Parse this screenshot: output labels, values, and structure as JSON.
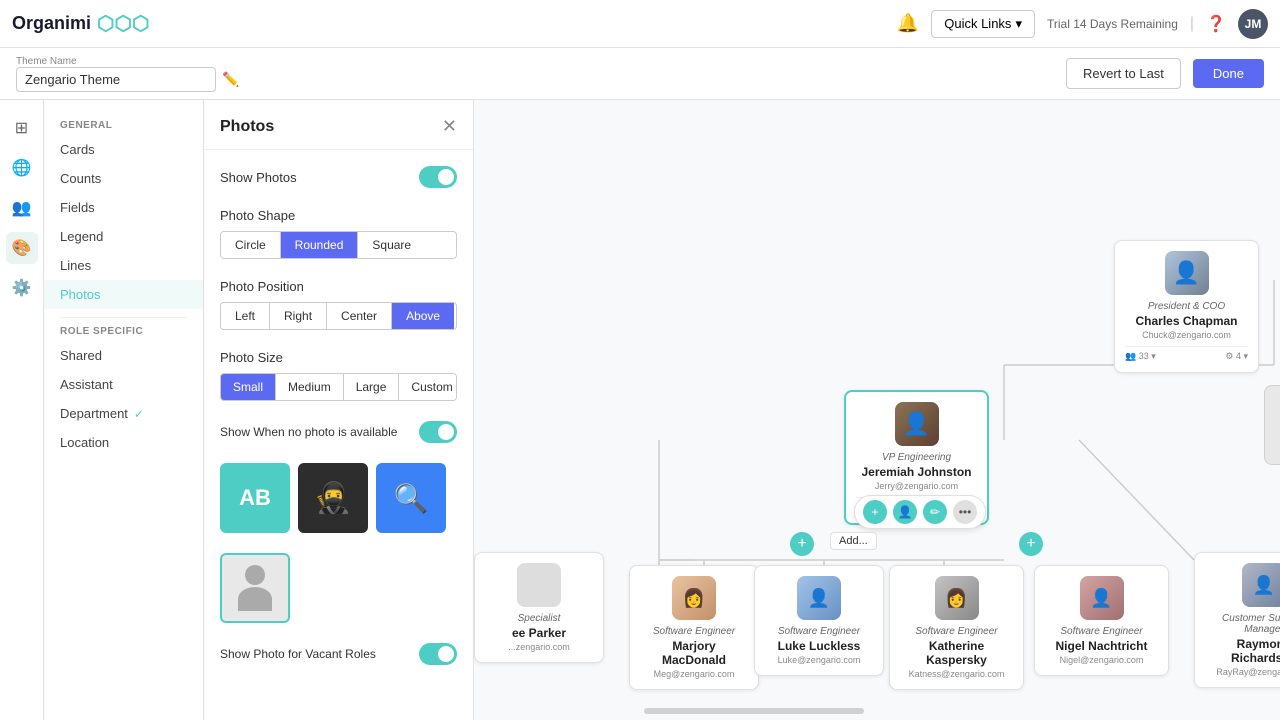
{
  "topbar": {
    "logo_text": "Organimi",
    "quick_links_label": "Quick Links",
    "trial_text": "Trial 14 Days Remaining",
    "avatar_initials": "JM"
  },
  "theme_bar": {
    "theme_label": "Theme Name",
    "theme_name": "Zengario Theme",
    "revert_label": "Revert to Last",
    "done_label": "Done"
  },
  "settings_nav": {
    "general_label": "GENERAL",
    "items": [
      {
        "label": "Cards",
        "active": false
      },
      {
        "label": "Counts",
        "active": false
      },
      {
        "label": "Fields",
        "active": false
      },
      {
        "label": "Legend",
        "active": false
      },
      {
        "label": "Lines",
        "active": false
      },
      {
        "label": "Photos",
        "active": true
      }
    ],
    "role_specific_label": "ROLE SPECIFIC",
    "role_items": [
      {
        "label": "Shared",
        "active": false,
        "check": false
      },
      {
        "label": "Assistant",
        "active": false,
        "check": false
      },
      {
        "label": "Department",
        "active": false,
        "check": true
      },
      {
        "label": "Location",
        "active": false,
        "check": false
      }
    ]
  },
  "photos_panel": {
    "title": "Photos",
    "show_photos_label": "Show Photos",
    "photo_shape_label": "Photo Shape",
    "shapes": [
      "Circle",
      "Rounded",
      "Square"
    ],
    "active_shape": "Rounded",
    "photo_position_label": "Photo Position",
    "positions": [
      "Left",
      "Right",
      "Center",
      "Above"
    ],
    "active_position": "Above",
    "photo_size_label": "Photo Size",
    "sizes": [
      "Small",
      "Medium",
      "Large",
      "Custom"
    ],
    "active_size": "Small",
    "show_no_photo_label": "Show When no photo is available",
    "show_vacant_label": "Show Photo for Vacant Roles"
  },
  "org": {
    "coo_card": {
      "role": "President & COO",
      "name": "Charles Chapman",
      "email": "Chuck@zengario.com"
    },
    "vp_card": {
      "role": "VP Engineering",
      "name": "Jeremiah Johnston",
      "email": "Jerry@zengario.com"
    },
    "engineers": [
      {
        "role": "Software Engineer",
        "name": "Marjory MacDonald",
        "email": "Meg@zengario.com"
      },
      {
        "role": "Software Engineer",
        "name": "Luke Luckless",
        "email": "Luke@zengario.com"
      },
      {
        "role": "Software Engineer",
        "name": "Katherine Kaspersky",
        "email": "Katness@zengario.com"
      },
      {
        "role": "Software Engineer",
        "name": "Nigel Nachtricht",
        "email": "Nigel@zengario.com"
      }
    ],
    "cs_card": {
      "role": "Customer Success Manager",
      "name": "Raymond Richardson",
      "email": "RayRay@zengario.com"
    },
    "specialist_partial": {
      "role": "Specialist",
      "name": "ee Parker",
      "email": "...zengario.com"
    }
  }
}
